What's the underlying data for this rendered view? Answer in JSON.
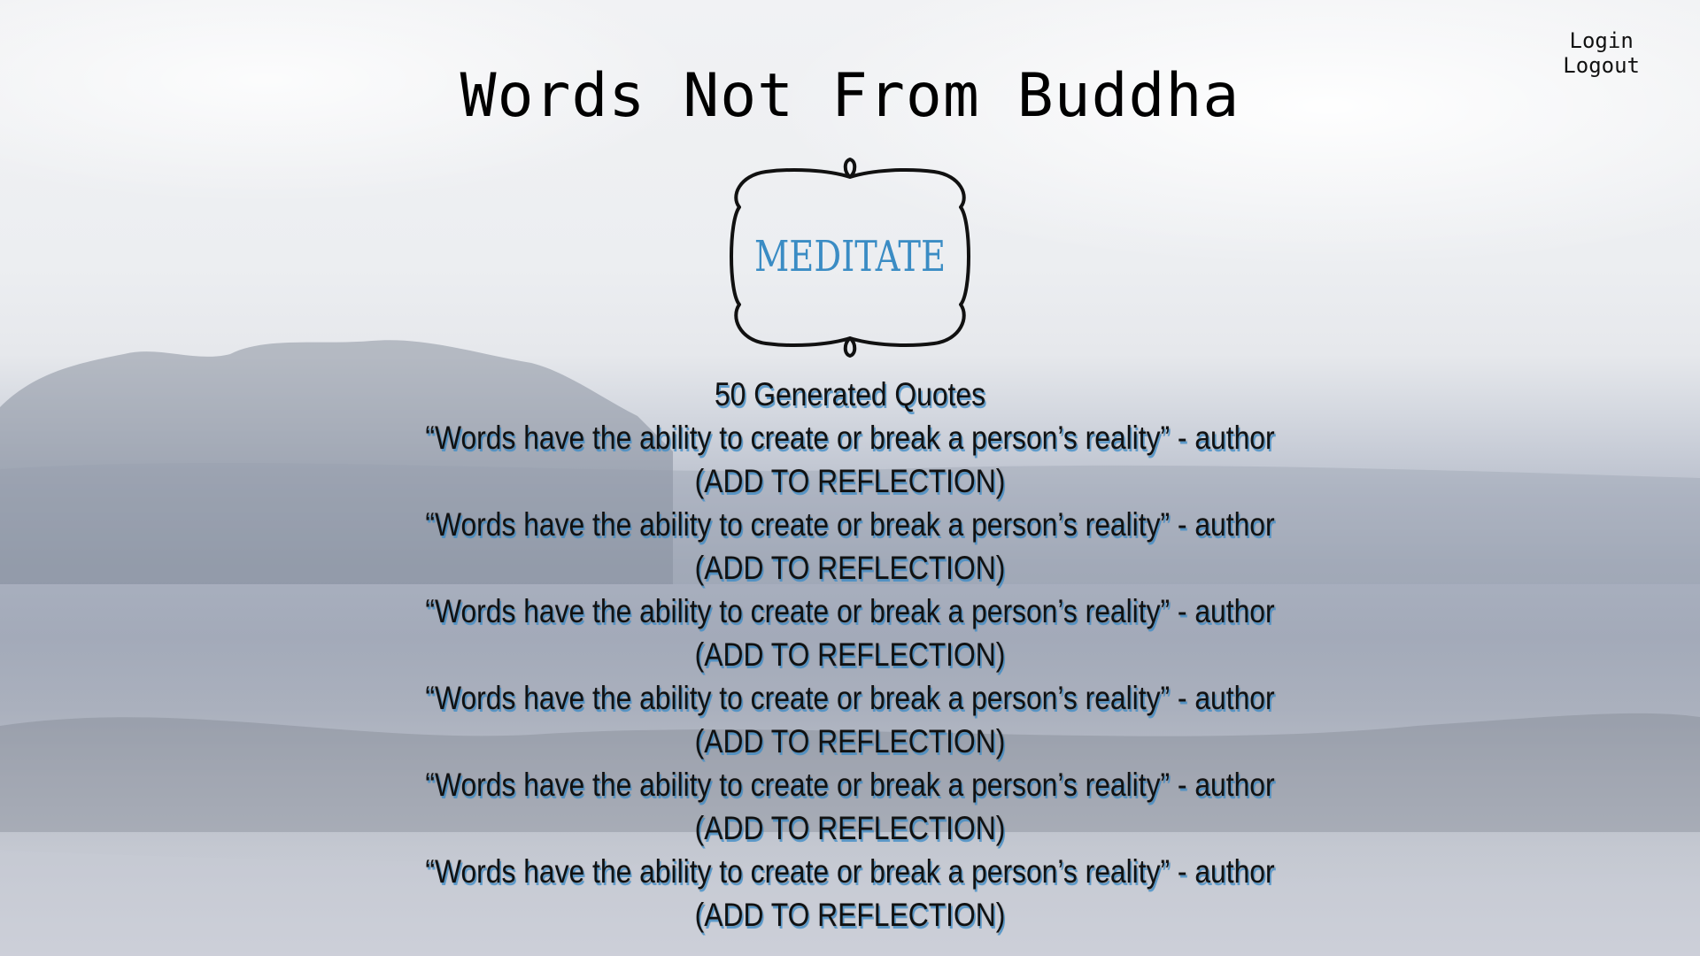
{
  "header": {
    "title": "Words Not From Buddha",
    "login_label": "Login",
    "logout_label": "Logout"
  },
  "logo": {
    "text": "MEDITATE",
    "text_color": "#3a8cc4"
  },
  "quotes": {
    "count_label": "50 Generated Quotes",
    "items": [
      {
        "text": "“Words have the ability to create or break a person’s reality” - author",
        "action": "(ADD TO REFLECTION)"
      },
      {
        "text": "“Words have the ability to create or break a person’s reality” - author",
        "action": "(ADD TO REFLECTION)"
      },
      {
        "text": "“Words have the ability to create or break a person’s reality” - author",
        "action": "(ADD TO REFLECTION)"
      },
      {
        "text": "“Words have the ability to create or break a person’s reality” - author",
        "action": "(ADD TO REFLECTION)"
      },
      {
        "text": "“Words have the ability to create or break a person’s reality” - author",
        "action": "(ADD TO REFLECTION)"
      },
      {
        "text": "“Words have the ability to create or break a person’s reality” - author",
        "action": "(ADD TO REFLECTION)"
      }
    ]
  }
}
